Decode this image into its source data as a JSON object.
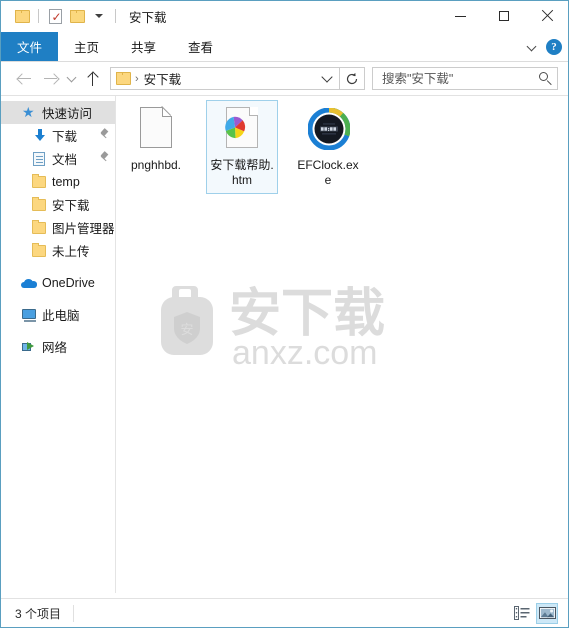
{
  "window": {
    "title": "安下载",
    "accent": "#1f7fc4",
    "border_color": "#5a9fc0"
  },
  "quick_access_toolbar": {
    "items": [
      {
        "name": "folder-icon",
        "label": ""
      },
      {
        "name": "properties-icon",
        "label": ""
      },
      {
        "name": "new-folder-icon",
        "label": ""
      },
      {
        "name": "customize-dropdown-icon",
        "label": ""
      }
    ]
  },
  "window_controls": {
    "minimize": "─",
    "maximize": "□",
    "close": "✕"
  },
  "ribbon": {
    "tabs": [
      {
        "label": "文件",
        "active": true
      },
      {
        "label": "主页",
        "active": false
      },
      {
        "label": "共享",
        "active": false
      },
      {
        "label": "查看",
        "active": false
      }
    ],
    "expand_label": "",
    "help_label": "?"
  },
  "navbar": {
    "back_tooltip": "后退",
    "forward_tooltip": "前进",
    "recent_tooltip": "最近浏览的位置",
    "up_tooltip": "上移一级",
    "address": {
      "separator": "›",
      "path": "安下载"
    },
    "refresh_tooltip": "刷新",
    "search": {
      "placeholder": "搜索\"安下载\"",
      "value": ""
    }
  },
  "sidebar": {
    "items": [
      {
        "label": "快速访问",
        "icon": "star-pin-icon",
        "level": 0,
        "selected": true,
        "pinned": false
      },
      {
        "label": "下载",
        "icon": "downloads-icon",
        "level": 1,
        "selected": false,
        "pinned": true
      },
      {
        "label": "文档",
        "icon": "documents-icon",
        "level": 1,
        "selected": false,
        "pinned": true
      },
      {
        "label": "temp",
        "icon": "folder-icon",
        "level": 1,
        "selected": false,
        "pinned": false
      },
      {
        "label": "安下载",
        "icon": "folder-icon",
        "level": 1,
        "selected": false,
        "pinned": false
      },
      {
        "label": "图片管理器",
        "icon": "folder-icon",
        "level": 1,
        "selected": false,
        "pinned": false
      },
      {
        "label": "未上传",
        "icon": "folder-icon",
        "level": 1,
        "selected": false,
        "pinned": false
      },
      {
        "label": "OneDrive",
        "icon": "cloud-icon",
        "level": 0,
        "selected": false,
        "pinned": false
      },
      {
        "label": "此电脑",
        "icon": "computer-icon",
        "level": 0,
        "selected": false,
        "pinned": false
      },
      {
        "label": "网络",
        "icon": "network-icon",
        "level": 0,
        "selected": false,
        "pinned": false
      }
    ]
  },
  "files": {
    "items": [
      {
        "label": "pnghhbd.",
        "icon": "blank-document-icon",
        "selected": false
      },
      {
        "label": "安下载帮助.htm",
        "icon": "html-document-icon",
        "selected": true
      },
      {
        "label": "EFClock.exe",
        "icon": "efclock-app-icon",
        "selected": false
      }
    ]
  },
  "watermark": {
    "brand_cn": "安下载",
    "brand_domain": "anxz.com",
    "shield_char": "安",
    "color": "#d9d9d9"
  },
  "statusbar": {
    "item_count_text": "3 个项目",
    "views": [
      {
        "name": "details-view-button",
        "active": false
      },
      {
        "name": "large-icons-view-button",
        "active": true
      }
    ]
  }
}
